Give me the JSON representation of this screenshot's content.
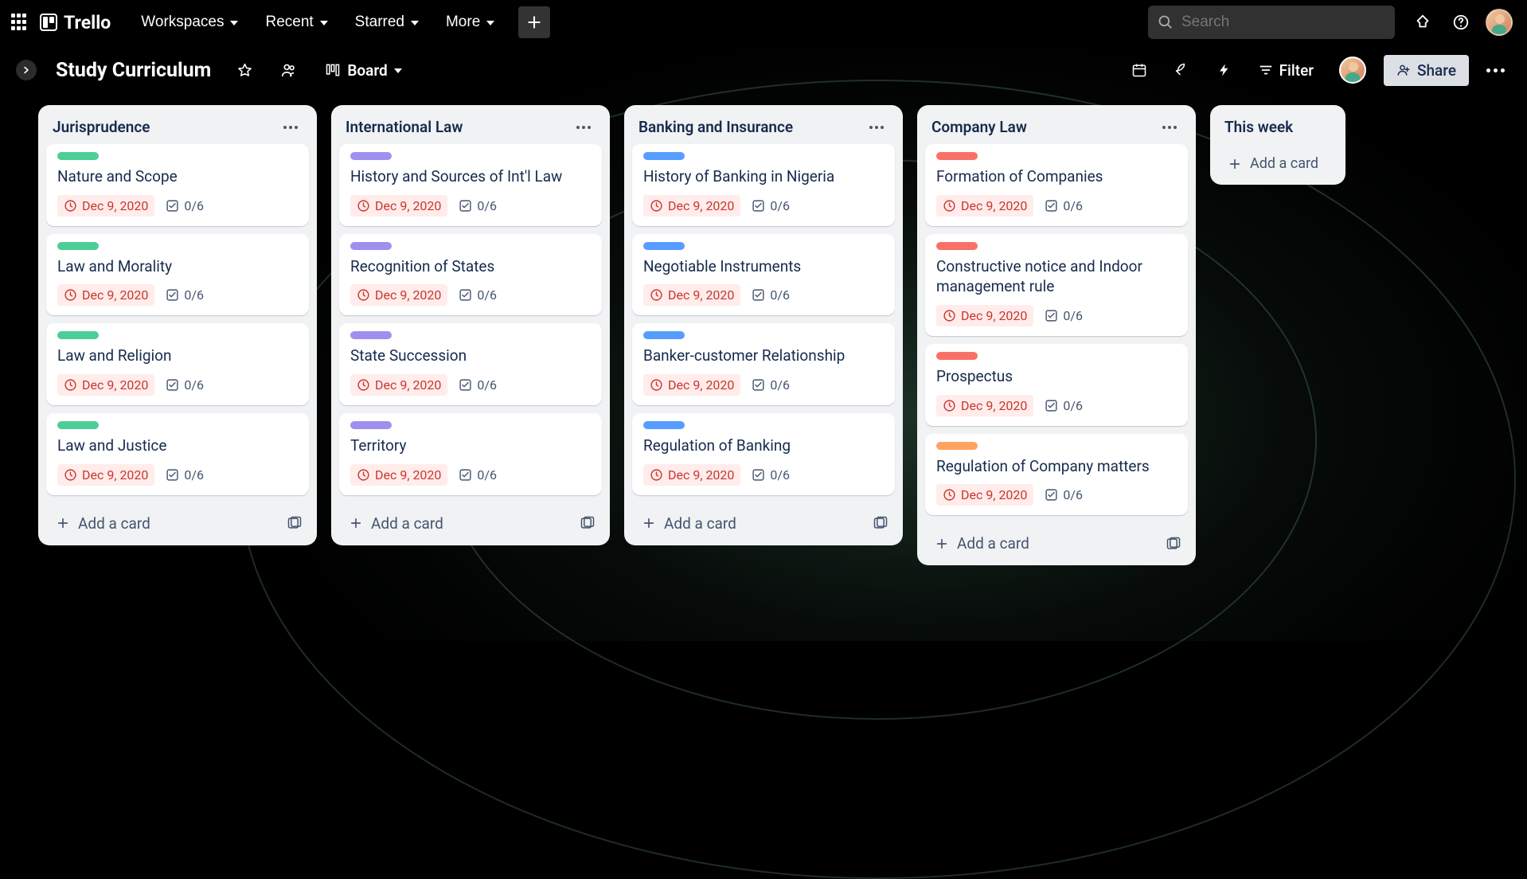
{
  "app": {
    "name": "Trello"
  },
  "nav": {
    "workspaces": "Workspaces",
    "recent": "Recent",
    "starred": "Starred",
    "more": "More"
  },
  "search": {
    "placeholder": "Search"
  },
  "board": {
    "title": "Study Curriculum",
    "view": "Board",
    "filter": "Filter",
    "share": "Share"
  },
  "labels": {
    "green": "#4bce97",
    "purple": "#9f8fef",
    "blue": "#579dff",
    "red": "#f87168",
    "orange": "#fea362"
  },
  "common": {
    "add_card": "Add a card",
    "due": "Dec 9, 2020",
    "checklist": "0/6"
  },
  "lists": [
    {
      "title": "Jurisprudence",
      "label": "green",
      "cards": [
        {
          "title": "Nature and Scope"
        },
        {
          "title": "Law and Morality"
        },
        {
          "title": "Law and Religion"
        },
        {
          "title": "Law and Justice"
        }
      ]
    },
    {
      "title": "International Law",
      "label": "purple",
      "cards": [
        {
          "title": "History and Sources of Int'l Law"
        },
        {
          "title": "Recognition of States"
        },
        {
          "title": "State Succession"
        },
        {
          "title": "Territory"
        }
      ]
    },
    {
      "title": "Banking and Insurance",
      "label": "blue",
      "cards": [
        {
          "title": "History of Banking in Nigeria"
        },
        {
          "title": "Negotiable Instruments"
        },
        {
          "title": "Banker-customer Relationship"
        },
        {
          "title": "Regulation of Banking"
        }
      ]
    },
    {
      "title": "Company Law",
      "label": "red",
      "cards": [
        {
          "title": "Formation of Companies"
        },
        {
          "title": "Constructive notice and Indoor management rule"
        },
        {
          "title": "Prospectus",
          "label": "red"
        },
        {
          "title": "Regulation of Company matters",
          "label": "orange"
        }
      ]
    },
    {
      "title": "This week",
      "small": true,
      "cards": []
    }
  ]
}
